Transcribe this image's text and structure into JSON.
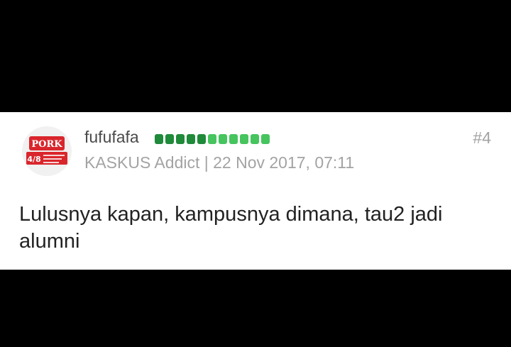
{
  "post": {
    "username": "fufufafa",
    "post_number": "#4",
    "rank": "KASKUS Addict",
    "separator": "|",
    "timestamp": "22 Nov 2017, 07:11",
    "content": "Lulusnya kapan, kampusnya dimana, tau2 jadi alumni",
    "reputation_dots_dark": 5,
    "reputation_dots_light": 6,
    "colors": {
      "rep_dark": "#1f8a3a",
      "rep_light": "#46c45e",
      "avatar_red": "#d9262c",
      "username": "#4a4a4a",
      "meta": "#a3a3a3",
      "body_text": "#222222"
    },
    "avatar": {
      "logo_text": "PORK",
      "badge_text": "4/8"
    }
  }
}
